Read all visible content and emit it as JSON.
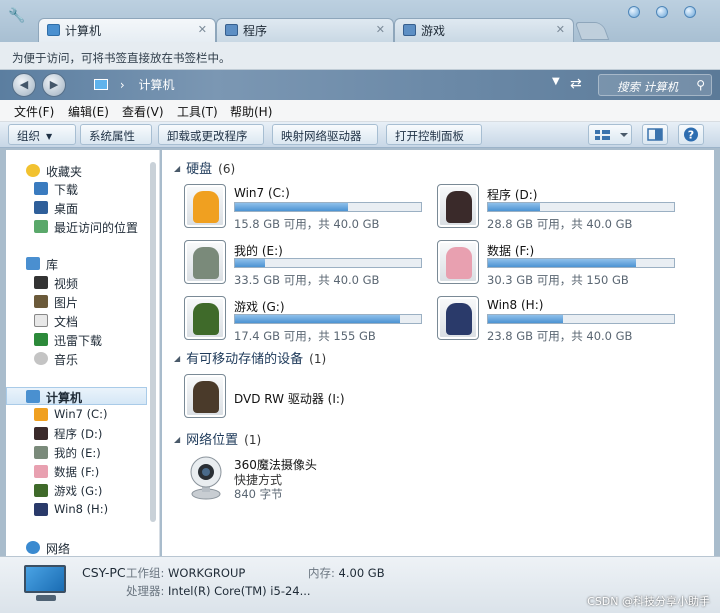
{
  "tabs": [
    {
      "label": "计算机",
      "active": true
    },
    {
      "label": "程序",
      "active": false
    },
    {
      "label": "游戏",
      "active": false
    }
  ],
  "hint_bar": {
    "text": "为便于访问，可将书签直接放在书签栏中。"
  },
  "address": {
    "path": "计算机",
    "search_placeholder": "搜索 计算机"
  },
  "menu": [
    "文件(F)",
    "编辑(E)",
    "查看(V)",
    "工具(T)",
    "帮助(H)"
  ],
  "commands": {
    "organize": "组织",
    "system_properties": "系统属性",
    "uninstall": "卸载或更改程序",
    "map_drive": "映射网络驱动器",
    "control_panel": "打开控制面板"
  },
  "sidebar": {
    "favorites_header": "收藏夹",
    "favorites": [
      "下载",
      "桌面",
      "最近访问的位置"
    ],
    "library_header": "库",
    "libraries": [
      "视频",
      "图片",
      "文档",
      "迅雷下载",
      "音乐"
    ],
    "computer_header": "计算机",
    "drives": [
      "Win7 (C:)",
      "程序 (D:)",
      "我的 (E:)",
      "数据 (F:)",
      "游戏 (G:)",
      "Win8 (H:)"
    ],
    "network_header": "网络"
  },
  "groups": {
    "hard_disks": {
      "title": "硬盘",
      "count": "(6)"
    },
    "removable": {
      "title": "有可移动存储的设备",
      "count": "(1)"
    },
    "network": {
      "title": "网络位置",
      "count": "(1)"
    }
  },
  "drives": [
    {
      "name": "Win7 (C:)",
      "size": "15.8 GB 可用，共 40.0 GB",
      "used_fraction": 0.605
    },
    {
      "name": "程序 (D:)",
      "size": "28.8 GB 可用，共 40.0 GB",
      "used_fraction": 0.28
    },
    {
      "name": "我的 (E:)",
      "size": "33.5 GB 可用，共 40.0 GB",
      "used_fraction": 0.163
    },
    {
      "name": "数据 (F:)",
      "size": "30.3 GB 可用，共 150 GB",
      "used_fraction": 0.798
    },
    {
      "name": "游戏 (G:)",
      "size": "17.4 GB 可用，共 155 GB",
      "used_fraction": 0.888
    },
    {
      "name": "Win8 (H:)",
      "size": "23.8 GB 可用，共 40.0 GB",
      "used_fraction": 0.405
    }
  ],
  "removable_device": {
    "name": "DVD RW 驱动器 (I:)"
  },
  "network_location": {
    "name": "360魔法摄像头",
    "type": "快捷方式",
    "size": "840 字节"
  },
  "details": {
    "pc_name": "CSY-PC",
    "workgroup_label": "工作组:",
    "workgroup": "WORKGROUP",
    "memory_label": "内存:",
    "memory": "4.00 GB",
    "processor_label": "处理器:",
    "processor": "Intel(R) Core(TM) i5-24..."
  },
  "watermark": "CSDN @科技分享小助手",
  "colors": {
    "accent": "#4c93d2",
    "address_bar": "#6c8aa8"
  }
}
